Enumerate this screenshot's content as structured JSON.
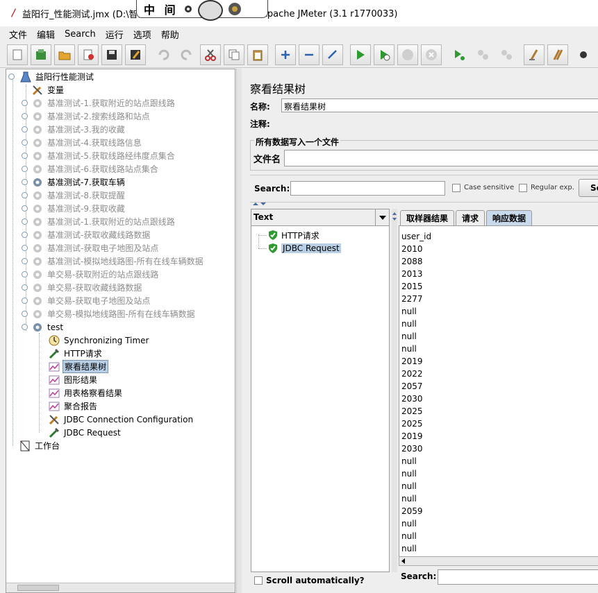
{
  "window": {
    "title_left": "益阳行_性能测试.jmx (D:\\智慧",
    "title_right": ") - Apache JMeter (3.1 r1770033)",
    "overlay_text": "中 间"
  },
  "menu": [
    "文件",
    "编辑",
    "Search",
    "运行",
    "选项",
    "帮助"
  ],
  "toolbar": {
    "icons": [
      "new-icon",
      "templates-icon",
      "open-icon",
      "close-icon",
      "save-icon",
      "save-as-icon",
      "undo-icon",
      "redo-icon",
      "cut-icon",
      "copy-icon",
      "paste-icon",
      "expand-icon",
      "collapse-icon",
      "toggle-icon",
      "start-icon",
      "start-no-pause-icon",
      "stop-icon",
      "shutdown-icon",
      "remote-start-icon",
      "remote-stop-icon",
      "remote-shutdown-icon",
      "clear-icon",
      "clear-all-icon",
      "search-icon"
    ]
  },
  "tree": {
    "root": "益阳行性能测试",
    "items": [
      {
        "label": "变量",
        "icon": "wrench-icon",
        "state": "normal"
      },
      {
        "label": "基准测试-1.获取附近的站点跟线路",
        "icon": "gear-icon",
        "state": "disabled"
      },
      {
        "label": "基准测试-2.搜索线路和站点",
        "icon": "gear-icon",
        "state": "disabled"
      },
      {
        "label": "基准测试-3.我的收藏",
        "icon": "gear-icon",
        "state": "disabled"
      },
      {
        "label": "基准测试-4.获取线路信息",
        "icon": "gear-icon",
        "state": "disabled"
      },
      {
        "label": "基准测试-5.获取线路经纬度点集合",
        "icon": "gear-icon",
        "state": "disabled"
      },
      {
        "label": "基准测试-6.获取线路站点集合",
        "icon": "gear-icon",
        "state": "disabled"
      },
      {
        "label": "基准测试-7.获取车辆",
        "icon": "gear-icon",
        "state": "normal"
      },
      {
        "label": "基准测试-8.获取提醒",
        "icon": "gear-icon",
        "state": "disabled"
      },
      {
        "label": "基准测试-9.获取收藏",
        "icon": "gear-icon",
        "state": "disabled"
      },
      {
        "label": "基准测试-1.获取附近的站点跟线路",
        "icon": "gear-icon",
        "state": "disabled"
      },
      {
        "label": "基准测试-获取收藏线路数据",
        "icon": "gear-icon",
        "state": "disabled"
      },
      {
        "label": "基准测试-获取电子地图及站点",
        "icon": "gear-icon",
        "state": "disabled"
      },
      {
        "label": "基准测试-模拟地线路图-所有在线车辆数据",
        "icon": "gear-icon",
        "state": "disabled"
      },
      {
        "label": "单交易-获取附近的站点跟线路",
        "icon": "gear-icon",
        "state": "disabled"
      },
      {
        "label": "单交易-获取收藏线路数据",
        "icon": "gear-icon",
        "state": "disabled"
      },
      {
        "label": "单交易-获取电子地图及站点",
        "icon": "gear-icon",
        "state": "disabled"
      },
      {
        "label": "单交易-模拟地线路图-所有在线车辆数据",
        "icon": "gear-icon",
        "state": "disabled"
      },
      {
        "label": "test",
        "icon": "gear-icon",
        "state": "normal"
      }
    ],
    "children": [
      {
        "label": "Synchronizing Timer",
        "icon": "timer-icon",
        "state": "normal"
      },
      {
        "label": "HTTP请求",
        "icon": "pipette-icon",
        "state": "normal"
      },
      {
        "label": "察看结果树",
        "icon": "graph-icon",
        "state": "selected"
      },
      {
        "label": "图形结果",
        "icon": "graph-icon",
        "state": "normal"
      },
      {
        "label": "用表格察看结果",
        "icon": "graph-icon",
        "state": "normal"
      },
      {
        "label": "聚合报告",
        "icon": "graph-icon",
        "state": "normal"
      },
      {
        "label": "JDBC Connection Configuration",
        "icon": "wrench-icon",
        "state": "normal"
      },
      {
        "label": "JDBC Request",
        "icon": "pipette-icon",
        "state": "normal"
      }
    ],
    "workbench": "工作台"
  },
  "panel": {
    "title": "察看结果树",
    "name_label": "名称:",
    "name_value": "察看结果树",
    "comment_label": "注释:",
    "group_title": "所有数据写入一个文件",
    "file_label": "文件名",
    "search_label": "Search:",
    "case_sensitive": "Case sensitive",
    "regex": "Regular exp.",
    "search_button": "Se"
  },
  "results": {
    "renderer": "Text",
    "samples": [
      {
        "label": "HTTP请求",
        "selected": false
      },
      {
        "label": "JDBC Request",
        "selected": true
      }
    ],
    "scroll_auto": "Scroll automatically?"
  },
  "tabs": [
    "取样器结果",
    "请求",
    "响应数据"
  ],
  "response": {
    "lines": [
      "user_id",
      "2010",
      "2088",
      "2013",
      "2015",
      "2277",
      "null",
      "null",
      "null",
      "null",
      "2019",
      "2022",
      "2057",
      "2030",
      "2025",
      "2025",
      "2019",
      "2030",
      "null",
      "null",
      "null",
      "null",
      "2059",
      "null",
      "null",
      "null"
    ],
    "search_label": "Search:"
  }
}
